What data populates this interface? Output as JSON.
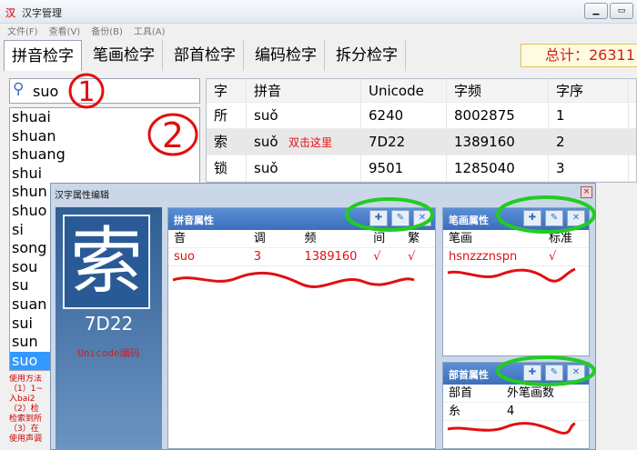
{
  "window": {
    "title": "汉字管理",
    "icon": "app-icon"
  },
  "menu": [
    "文件(F)",
    "查看(V)",
    "备份(B)",
    "工具(A)"
  ],
  "tabs": [
    "拼音检字",
    "笔画检字",
    "部首检字",
    "编码检字",
    "拆分检字"
  ],
  "total": "总计：26311",
  "search": {
    "value": "suo",
    "annotation": "1"
  },
  "list": [
    "shuai",
    "shuan",
    "shuang",
    "shui",
    "shun",
    "shuo",
    "si",
    "song",
    "sou",
    "su",
    "suan",
    "sui",
    "sun",
    "suo"
  ],
  "list_selected": "suo",
  "list_annotation": "2",
  "help": [
    "使用方法",
    "（1）1~",
    "入bai2",
    "（2）检",
    "检索到所",
    "（3）在",
    "使用声调"
  ],
  "grid": {
    "headers": [
      "字",
      "拼音",
      "Unicode",
      "字频",
      "字序"
    ],
    "rows": [
      [
        "所",
        "suǒ",
        "6240",
        "8002875",
        "1"
      ],
      [
        "索",
        "suǒ",
        "7D22",
        "1389160",
        "2"
      ],
      [
        "锁",
        "suǒ",
        "9501",
        "1285040",
        "3"
      ]
    ],
    "hint": "双击这里"
  },
  "dialog": {
    "title": "汉字属性编辑",
    "close": "×",
    "char": "索",
    "code": "7D22",
    "code_label": "Unicode编码",
    "pinyin_panel": {
      "title": "拼音属性",
      "headers": [
        "音",
        "调",
        "频",
        "间",
        "繁"
      ],
      "rows": [
        [
          "suo",
          "3",
          "1389160",
          "√",
          "√"
        ]
      ]
    },
    "stroke_panel": {
      "title": "笔画属性",
      "headers": [
        "笔画",
        "标准"
      ],
      "rows": [
        [
          "hsnzzznspn",
          "√"
        ]
      ]
    },
    "radical_panel": {
      "title": "部首属性",
      "headers": [
        "部首",
        "外笔画数"
      ],
      "rows": [
        [
          "糸",
          "4"
        ]
      ]
    }
  },
  "colors": {
    "annotation": "#e01010",
    "highlight": "#22cc22",
    "selected": "#3399ff"
  }
}
